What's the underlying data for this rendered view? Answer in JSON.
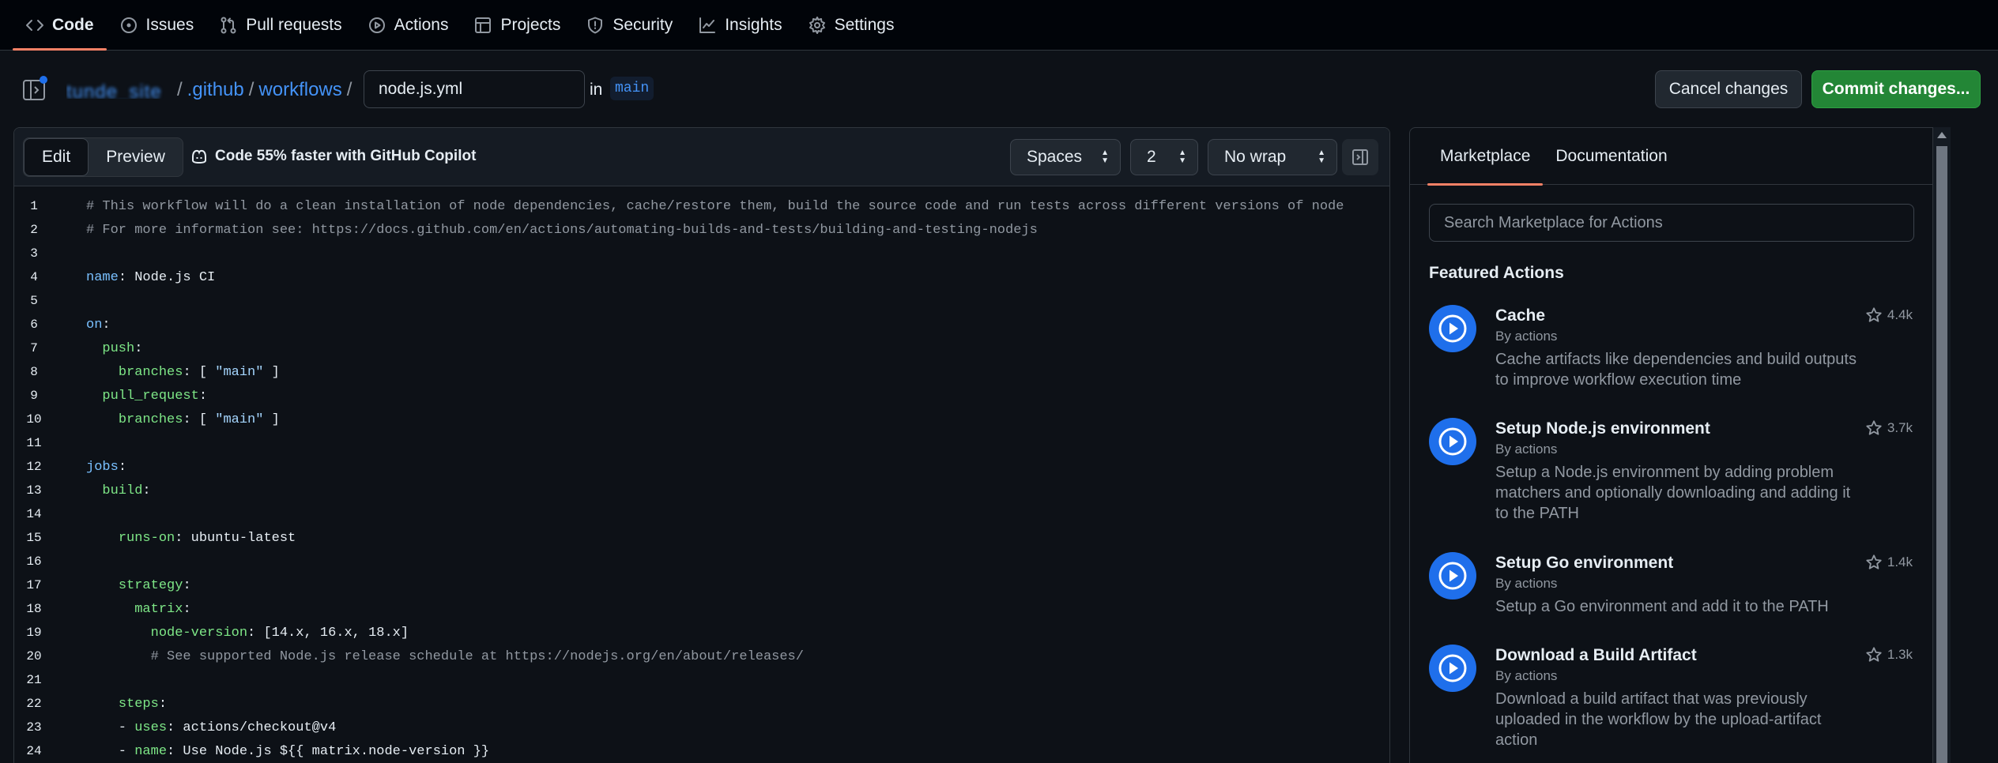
{
  "nav": {
    "tabs": [
      {
        "label": "Code",
        "icon": "code-icon"
      },
      {
        "label": "Issues",
        "icon": "issue-icon"
      },
      {
        "label": "Pull requests",
        "icon": "pull-request-icon"
      },
      {
        "label": "Actions",
        "icon": "play-icon"
      },
      {
        "label": "Projects",
        "icon": "table-icon"
      },
      {
        "label": "Security",
        "icon": "shield-icon"
      },
      {
        "label": "Insights",
        "icon": "graph-icon"
      },
      {
        "label": "Settings",
        "icon": "gear-icon"
      }
    ],
    "active_tab": "Code"
  },
  "breadcrumb": {
    "repo": "tunde_site",
    "folder1": ".github",
    "folder2": "workflows",
    "separator": "/",
    "filename": "node.js.yml",
    "in_label": "in",
    "branch": "main"
  },
  "actions": {
    "cancel_label": "Cancel changes",
    "commit_label": "Commit changes..."
  },
  "editor": {
    "edit_label": "Edit",
    "preview_label": "Preview",
    "copilot_label": "Code 55% faster with GitHub Copilot",
    "indent_mode": "Spaces",
    "indent_size": "2",
    "wrap_mode": "No wrap"
  },
  "code_lines": [
    "# This workflow will do a clean installation of node dependencies, cache/restore them, build the source code and run tests across different versions of node",
    "# For more information see: https://docs.github.com/en/actions/automating-builds-and-tests/building-and-testing-nodejs",
    "",
    "name: Node.js CI",
    "",
    "on:",
    "  push:",
    "    branches: [ \"main\" ]",
    "  pull_request:",
    "    branches: [ \"main\" ]",
    "",
    "jobs:",
    "  build:",
    "",
    "    runs-on: ubuntu-latest",
    "",
    "    strategy:",
    "      matrix:",
    "        node-version: [14.x, 16.x, 18.x]",
    "        # See supported Node.js release schedule at https://nodejs.org/en/about/releases/",
    "",
    "    steps:",
    "    - uses: actions/checkout@v4",
    "    - name: Use Node.js ${{ matrix.node-version }}"
  ],
  "marketplace": {
    "tab_marketplace": "Marketplace",
    "tab_documentation": "Documentation",
    "search_placeholder": "Search Marketplace for Actions",
    "featured_heading": "Featured Actions",
    "items": [
      {
        "name": "Cache",
        "by": "By actions",
        "desc": "Cache artifacts like dependencies and build outputs to improve workflow execution time",
        "stars": "4.4k"
      },
      {
        "name": "Setup Node.js environment",
        "by": "By actions",
        "desc": "Setup a Node.js environment by adding problem matchers and optionally downloading and adding it to the PATH",
        "stars": "3.7k"
      },
      {
        "name": "Setup Go environment",
        "by": "By actions",
        "desc": "Setup a Go environment and add it to the PATH",
        "stars": "1.4k"
      },
      {
        "name": "Download a Build Artifact",
        "by": "By actions",
        "desc": "Download a build artifact that was previously uploaded in the workflow by the upload-artifact action",
        "stars": "1.3k"
      }
    ]
  },
  "colors": {
    "accent": "#f78166",
    "link": "#4493f8",
    "commit_green": "#238636",
    "action_blue": "#1f6feb"
  }
}
